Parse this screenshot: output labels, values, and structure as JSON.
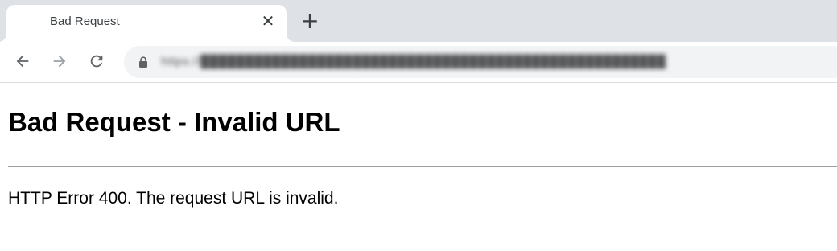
{
  "browser": {
    "tab": {
      "title": "Bad Request",
      "close_icon": "close-icon",
      "close_glyph": "✕"
    },
    "new_tab": {
      "icon": "plus-icon",
      "glyph": "+"
    },
    "toolbar": {
      "back_icon": "back-arrow-icon",
      "forward_icon": "forward-arrow-icon",
      "reload_icon": "reload-icon",
      "lock_icon": "lock-icon",
      "url": "https://████████████████████████████████████████████████████"
    }
  },
  "page": {
    "heading": "Bad Request - Invalid URL",
    "message": "HTTP Error 400. The request URL is invalid."
  },
  "colors": {
    "tab_strip": "#dee1e6",
    "omnibox": "#f1f3f4",
    "icon": "#5f6368",
    "disabled_icon": "#9aa0a6"
  }
}
